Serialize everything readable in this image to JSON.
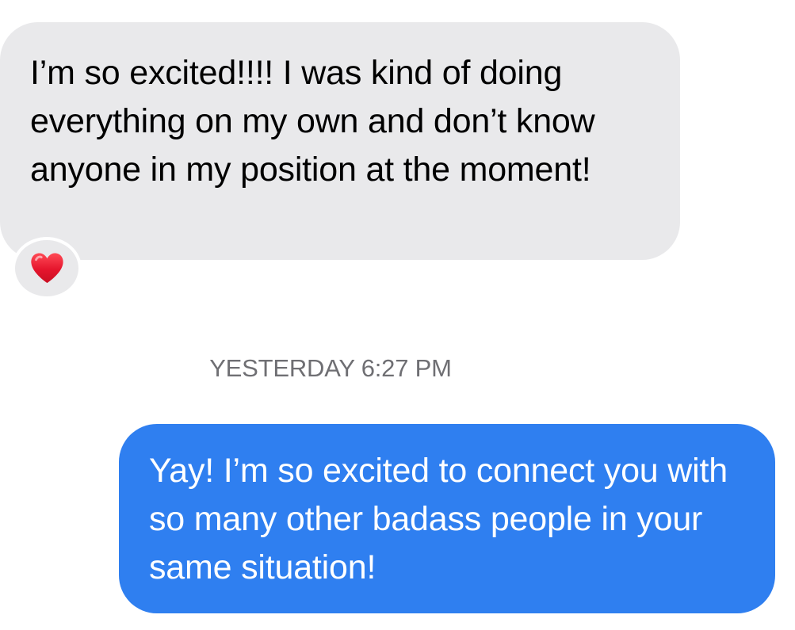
{
  "conversation": {
    "received_message": {
      "text": "I’m so excited!!!! I was kind of doing everything on my own and don’t know anyone in my position at the moment!",
      "reaction": {
        "icon": "red-heart-icon",
        "label": "❤️",
        "color": "#e5152d"
      }
    },
    "timestamp": "YESTERDAY 6:27 PM",
    "sent_message": {
      "text": "Yay! I’m so excited to connect you with so many other badass people in your same situation!"
    }
  },
  "colors": {
    "received_bubble": "#e9e9eb",
    "sent_bubble": "#2f7ff0",
    "timestamp": "#6f6f73",
    "background": "#ffffff"
  }
}
